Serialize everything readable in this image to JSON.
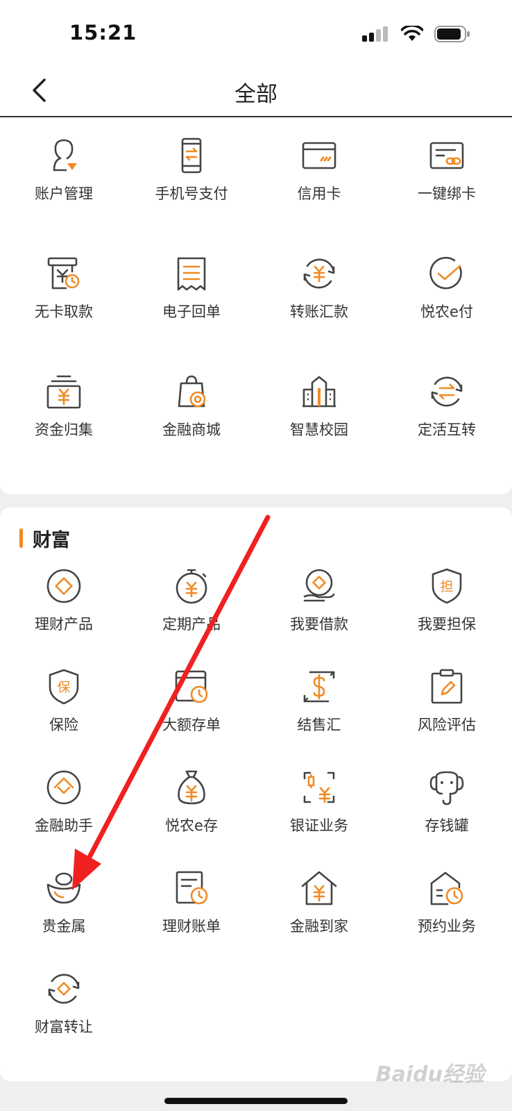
{
  "status": {
    "time": "15:21"
  },
  "nav": {
    "title": "全部"
  },
  "top_items": [
    {
      "label": "账户管理",
      "icon": "account-icon"
    },
    {
      "label": "手机号支付",
      "icon": "phone-pay-icon"
    },
    {
      "label": "信用卡",
      "icon": "credit-card-icon"
    },
    {
      "label": "一键绑卡",
      "icon": "bind-card-icon"
    },
    {
      "label": "无卡取款",
      "icon": "cardless-withdraw-icon"
    },
    {
      "label": "电子回单",
      "icon": "receipt-icon"
    },
    {
      "label": "转账汇款",
      "icon": "transfer-icon"
    },
    {
      "label": "悦农e付",
      "icon": "check-pay-icon"
    },
    {
      "label": "资金归集",
      "icon": "fund-collect-icon"
    },
    {
      "label": "金融商城",
      "icon": "shopping-bag-icon"
    },
    {
      "label": "智慧校园",
      "icon": "campus-icon"
    },
    {
      "label": "定活互转",
      "icon": "swap-icon"
    }
  ],
  "wealth": {
    "title": "财富",
    "items": [
      {
        "label": "理财产品",
        "icon": "wealth-product-icon"
      },
      {
        "label": "定期产品",
        "icon": "timer-yuan-icon"
      },
      {
        "label": "我要借款",
        "icon": "loan-icon"
      },
      {
        "label": "我要担保",
        "icon": "guarantee-shield-icon"
      },
      {
        "label": "保险",
        "icon": "insurance-shield-icon"
      },
      {
        "label": "大额存单",
        "icon": "deposit-cert-icon"
      },
      {
        "label": "结售汇",
        "icon": "exchange-dollar-icon"
      },
      {
        "label": "风险评估",
        "icon": "risk-assess-icon"
      },
      {
        "label": "金融助手",
        "icon": "assistant-icon"
      },
      {
        "label": "悦农e存",
        "icon": "money-bag-icon"
      },
      {
        "label": "银证业务",
        "icon": "securities-icon"
      },
      {
        "label": "存钱罐",
        "icon": "elephant-piggy-icon"
      },
      {
        "label": "贵金属",
        "icon": "gold-ingot-icon"
      },
      {
        "label": "理财账单",
        "icon": "bill-clock-icon"
      },
      {
        "label": "金融到家",
        "icon": "home-yuan-icon"
      },
      {
        "label": "预约业务",
        "icon": "appointment-icon"
      },
      {
        "label": "财富转让",
        "icon": "wealth-transfer-icon"
      }
    ]
  },
  "watermark": "Baidu经验",
  "colors": {
    "accent": "#f08a24",
    "icon_dark": "#444444",
    "arrow": "#f02020"
  }
}
